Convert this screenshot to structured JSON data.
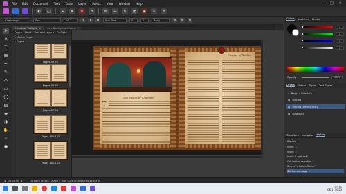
{
  "menubar": {
    "items": [
      "File",
      "Edit",
      "Document",
      "Text",
      "Table",
      "Layer",
      "Select",
      "View",
      "Window",
      "Help"
    ]
  },
  "context_bar": {
    "style_value": "Cambridge",
    "font_value": "Sea...",
    "size_value": "10.2",
    "paragraph_value": "Sub Title",
    "tracking_value": "0",
    "kerning_value": "0",
    "align_value": "Body"
  },
  "doc_tabs": [
    {
      "label": "Hearts of Twilight",
      "active": true
    },
    {
      "label": "as a Daylight of Ashes",
      "active": false
    }
  ],
  "pages_panel": {
    "tabs": [
      "Pages",
      "Stock",
      "Text and Layers",
      "Preflight"
    ],
    "sections": [
      "Master Pages",
      "Pages"
    ],
    "spreads": [
      {
        "caption": "Pages 49-50"
      },
      {
        "caption": "Pages 55-56"
      },
      {
        "caption": "Pages 57-58"
      },
      {
        "caption": "Pages 100-102"
      },
      {
        "caption": "Pages 101-102"
      }
    ]
  },
  "document": {
    "chapter_title": "The Sword of Shadows",
    "dropcap": "T",
    "right_heading": "Chapter of Riddles"
  },
  "right_panel": {
    "tabs": [
      "Colour",
      "Swatches",
      "Stroke"
    ],
    "slider_values": [
      "0",
      "0",
      "0",
      "0"
    ],
    "opacity_label": "Opacity",
    "opacity_value": "100 %",
    "layers_tabs": [
      "Layers",
      "Effects",
      "Styles",
      "Text Styles"
    ],
    "layers": [
      {
        "name": "Body + Side Info",
        "selected": false
      },
      {
        "name": "Writing",
        "selected": false
      },
      {
        "name": "Writing (Empty text)",
        "selected": true
      },
      {
        "name": "(Graphic)",
        "selected": false
      }
    ],
    "history_tabs": [
      "Transform",
      "Navigator",
      "History"
    ],
    "history_label": "Preview",
    "history": [
      {
        "label": "Insert \"..\"",
        "selected": false
      },
      {
        "label": "Insert \"..\"",
        "selected": false
      },
      {
        "label": "Insert \"Layer set\"",
        "selected": false
      },
      {
        "label": "Set Control selection",
        "selected": false
      },
      {
        "label": "Delete \"v Goblin Ranks\"",
        "selected": false
      },
      {
        "label": "Set Current page",
        "selected": true
      }
    ]
  },
  "status": {
    "page": "58 of 76",
    "hint": "Drag to create. Shape a line. Click an object to select it."
  },
  "taskbar": {
    "time": "07:31",
    "date": "06/11/2023"
  }
}
